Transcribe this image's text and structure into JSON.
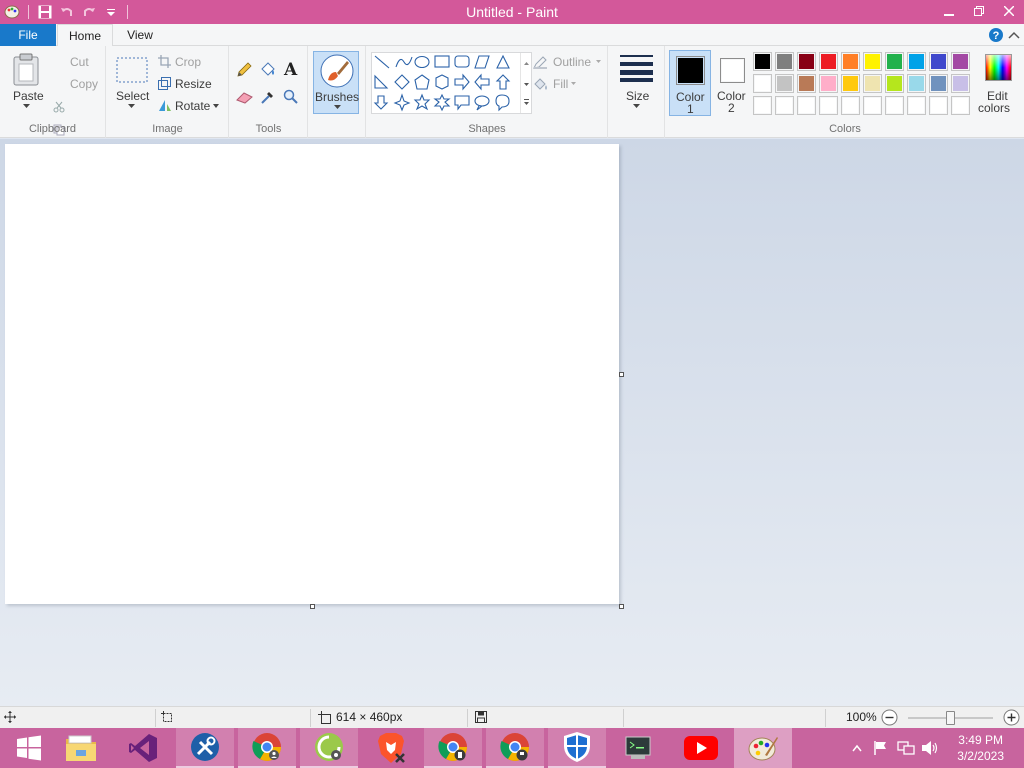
{
  "window": {
    "title": "Untitled - Paint",
    "colors": {
      "titlebar": "#d3589a",
      "accent": "#1979ca",
      "taskbar": "#c8649e"
    }
  },
  "quick_access": [
    "paint-app-icon",
    "save-icon",
    "undo-icon",
    "redo-icon",
    "customize-qat-icon"
  ],
  "tabs": {
    "file": "File",
    "home": "Home",
    "view": "View"
  },
  "clipboard": {
    "paste": "Paste",
    "cut": "Cut",
    "copy": "Copy",
    "group": "Clipboard"
  },
  "image": {
    "select": "Select",
    "crop": "Crop",
    "resize": "Resize",
    "rotate": "Rotate",
    "group": "Image"
  },
  "tools": {
    "group": "Tools",
    "text_glyph": "A"
  },
  "brushes": {
    "label": "Brushes"
  },
  "shapes": {
    "outline": "Outline",
    "fill": "Fill",
    "group": "Shapes"
  },
  "size": {
    "label": "Size"
  },
  "colors": {
    "color1_line1": "Color",
    "color1_line2": "1",
    "color2_line1": "Color",
    "color2_line2": "2",
    "edit_line1": "Edit",
    "edit_line2": "colors",
    "group": "Colors",
    "color1_value": "#000000",
    "color2_value": "#ffffff",
    "row1": [
      "#000000",
      "#7f7f7f",
      "#880015",
      "#ed1c24",
      "#ff7f27",
      "#fff200",
      "#22b14c",
      "#00a2e8",
      "#3f48cc",
      "#a349a4"
    ],
    "row2": [
      "#ffffff",
      "#c3c3c3",
      "#b97a57",
      "#ffaec9",
      "#ffc90e",
      "#efe4b0",
      "#b5e61d",
      "#99d9ea",
      "#7092be",
      "#c8bfe7"
    ],
    "row3": [
      "#ffffff",
      "#ffffff",
      "#ffffff",
      "#ffffff",
      "#ffffff",
      "#ffffff",
      "#ffffff",
      "#ffffff",
      "#ffffff",
      "#ffffff"
    ]
  },
  "status": {
    "canvas_size": "614 × 460px",
    "zoom": "100%",
    "zoom_slider_fraction": 0.5
  },
  "taskbar": {
    "apps": [
      "start-icon",
      "file-explorer-icon",
      "visual-studio-icon",
      "tools-icon",
      "chrome-icon",
      "app-icon",
      "brave-icon",
      "chrome-profile-icon",
      "chrome-profile-2-icon",
      "shield-icon",
      "terminal-icon",
      "youtube-icon",
      "paint-icon"
    ],
    "time": "3:49 PM",
    "date": "3/2/2023"
  }
}
